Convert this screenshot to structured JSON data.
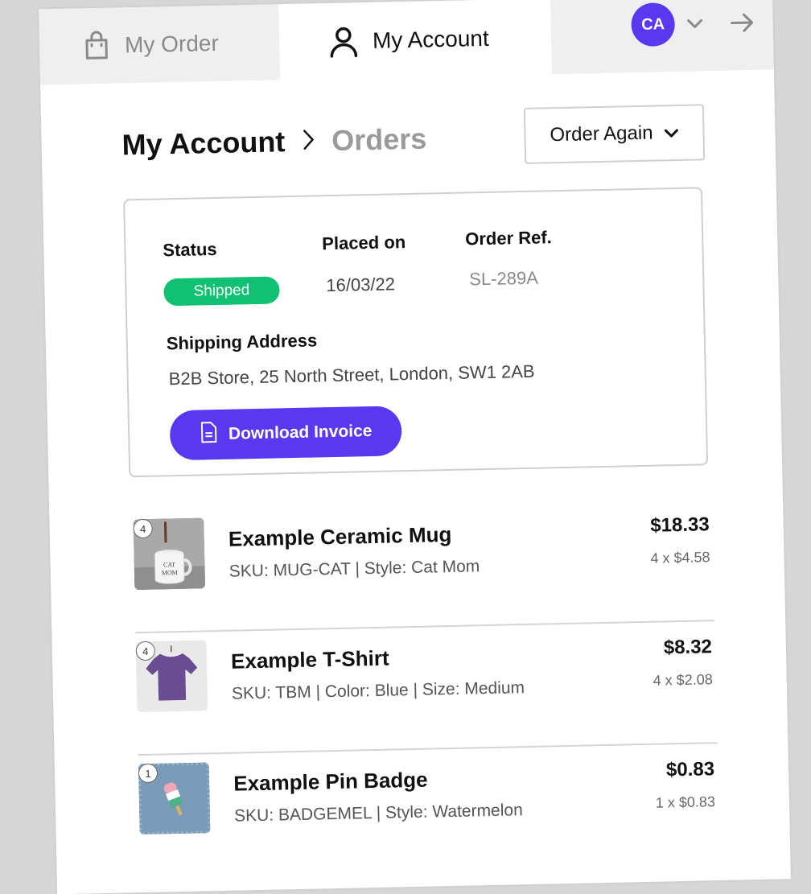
{
  "header": {
    "tab_order_label": "My Order",
    "tab_account_label": "My Account",
    "avatar_initials": "CA"
  },
  "breadcrumb": {
    "home": "My Account",
    "current": "Orders"
  },
  "actions": {
    "order_again_label": "Order Again"
  },
  "order": {
    "status_label": "Status",
    "status_value": "Shipped",
    "placed_label": "Placed on",
    "placed_value": "16/03/22",
    "ref_label": "Order Ref.",
    "ref_value": "SL-289A",
    "shipping_label": "Shipping Address",
    "shipping_value": "B2B Store, 25 North Street, London, SW1 2AB",
    "download_label": "Download Invoice"
  },
  "items": [
    {
      "qty": "4",
      "name": "Example Ceramic Mug",
      "meta": "SKU: MUG-CAT | Style: Cat Mom",
      "total": "$18.33",
      "unit": "4 x $4.58"
    },
    {
      "qty": "4",
      "name": "Example T-Shirt",
      "meta": "SKU: TBM | Color: Blue | Size: Medium",
      "total": "$8.32",
      "unit": "4 x $2.08"
    },
    {
      "qty": "1",
      "name": "Example Pin Badge",
      "meta": "SKU: BADGEMEL | Style: Watermelon",
      "total": "$0.83",
      "unit": "1 x $0.83"
    }
  ],
  "colors": {
    "accent": "#5a38f0",
    "status_green": "#10c174"
  },
  "icons": {
    "order_tab": "shopping-bag-icon",
    "account_tab": "user-icon",
    "avatar_menu": "chevron-down-icon",
    "exit": "arrow-right-icon",
    "breadcrumb_sep": "chevron-right-icon",
    "order_again": "chevron-down-icon",
    "download": "document-icon"
  }
}
